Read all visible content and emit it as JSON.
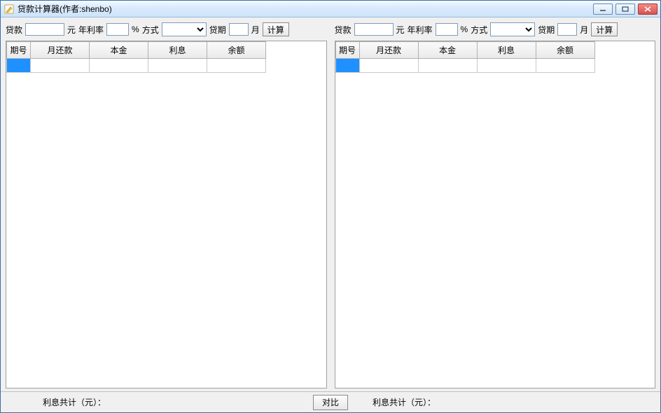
{
  "window": {
    "title": "贷款计算器(作者:shenbo)"
  },
  "toolbar": {
    "loan_label": "贷款",
    "loan_unit": "元",
    "rate_label": "年利率",
    "rate_unit": "%",
    "method_label": "方式",
    "period_label": "贷期",
    "period_unit": "月",
    "calc_label": "计算"
  },
  "left": {
    "loan_value": "",
    "rate_value": "",
    "method_value": "",
    "period_value": "",
    "interest_total": "利息共计（元）："
  },
  "right": {
    "loan_value": "",
    "rate_value": "",
    "method_value": "",
    "period_value": "",
    "interest_total": "利息共计（元）："
  },
  "table": {
    "headers": {
      "idx": "期号",
      "payment": "月还款",
      "principal": "本金",
      "interest": "利息",
      "balance": "余额"
    }
  },
  "footer": {
    "compare_label": "对比"
  }
}
